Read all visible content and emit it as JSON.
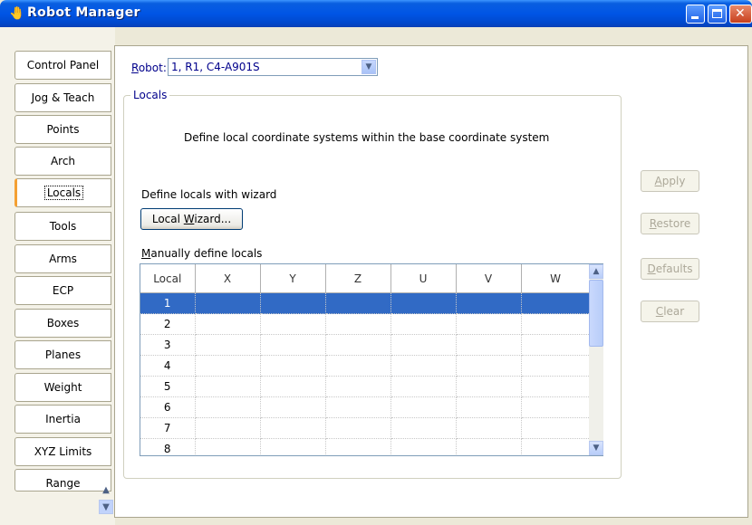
{
  "window": {
    "title": "Robot Manager"
  },
  "tabs": [
    {
      "label": "Control Panel"
    },
    {
      "label": "Jog & Teach"
    },
    {
      "label": "Points"
    },
    {
      "label": "Arch"
    },
    {
      "label": "Locals"
    },
    {
      "label": "Tools"
    },
    {
      "label": "Arms"
    },
    {
      "label": "ECP"
    },
    {
      "label": "Boxes"
    },
    {
      "label": "Planes"
    },
    {
      "label": "Weight"
    },
    {
      "label": "Inertia"
    },
    {
      "label": "XYZ Limits"
    },
    {
      "label": "Range"
    }
  ],
  "active_tab": "Locals",
  "robot": {
    "label_first": "R",
    "label_rest": "obot:",
    "selected": "1, R1, C4-A901S"
  },
  "locals": {
    "group_title": "Locals",
    "description": "Define local coordinate systems within the base coordinate system",
    "wizard_label": "Define locals with wizard",
    "wizard_button": {
      "pre": "Local ",
      "u": "W",
      "post": "izard..."
    },
    "manual_label": {
      "u": "M",
      "rest": "anually define locals"
    },
    "columns": [
      "Local",
      "X",
      "Y",
      "Z",
      "U",
      "V",
      "W"
    ],
    "rows": [
      "1",
      "2",
      "3",
      "4",
      "5",
      "6",
      "7",
      "8"
    ],
    "selected_row": "1"
  },
  "buttons": {
    "apply": {
      "u": "A",
      "rest": "pply"
    },
    "restore": {
      "u": "R",
      "rest": "estore"
    },
    "defaults": {
      "u": "D",
      "rest": "efaults"
    },
    "clear": {
      "u": "C",
      "rest": "lear"
    }
  }
}
